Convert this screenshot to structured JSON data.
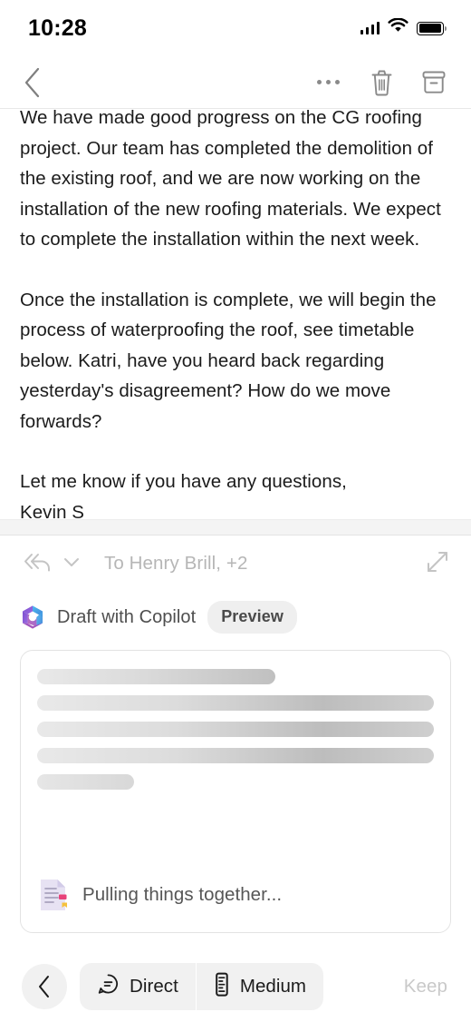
{
  "status_bar": {
    "time": "10:28",
    "signal_icon": "cellular-signal-icon",
    "wifi_icon": "wifi-icon",
    "battery_icon": "battery-full-icon"
  },
  "nav_bar": {
    "back_icon": "chevron-left-icon",
    "more_icon": "more-horizontal-icon",
    "delete_icon": "trash-icon",
    "archive_icon": "archive-icon"
  },
  "email": {
    "paragraphs": [
      "We have made good progress on the CG roofing project. Our team has completed the demolition of the existing roof, and we are now working on the installation of the new roofing materials. We expect to complete the installation within the next week.",
      "Once the installation is complete, we will begin the process of waterproofing the roof, see timetable below. Katri, have you heard back regarding yesterday's disagreement? How do we move forwards?",
      "Let me know if you have any questions,\nKevin S"
    ],
    "expand_quoted_icon": "more-horizontal-icon"
  },
  "reply_bar": {
    "reply_all_icon": "reply-all-icon",
    "chevron_icon": "chevron-down-icon",
    "recipients": "To Henry Brill, +2",
    "expand_icon": "expand-diagonal-icon"
  },
  "copilot": {
    "logo_icon": "copilot-logo-icon",
    "label": "Draft with Copilot",
    "badge": "Preview",
    "colors": {
      "logo_purple": "#8a62d6",
      "logo_blue": "#3aa9e8",
      "logo_pink": "#c964ab",
      "badge_bg": "#efefef"
    }
  },
  "draft_card": {
    "skeleton_widths": [
      "60%",
      "100%",
      "100%",
      "100%",
      "25%"
    ],
    "status_icon": "document-draft-icon",
    "status_text": "Pulling things together..."
  },
  "bottom_bar": {
    "back_icon": "chevron-left-icon",
    "tone_option": {
      "icon": "chat-tone-icon",
      "label": "Direct"
    },
    "length_option": {
      "icon": "ruler-icon",
      "label": "Medium"
    },
    "keep_label": "Keep"
  }
}
